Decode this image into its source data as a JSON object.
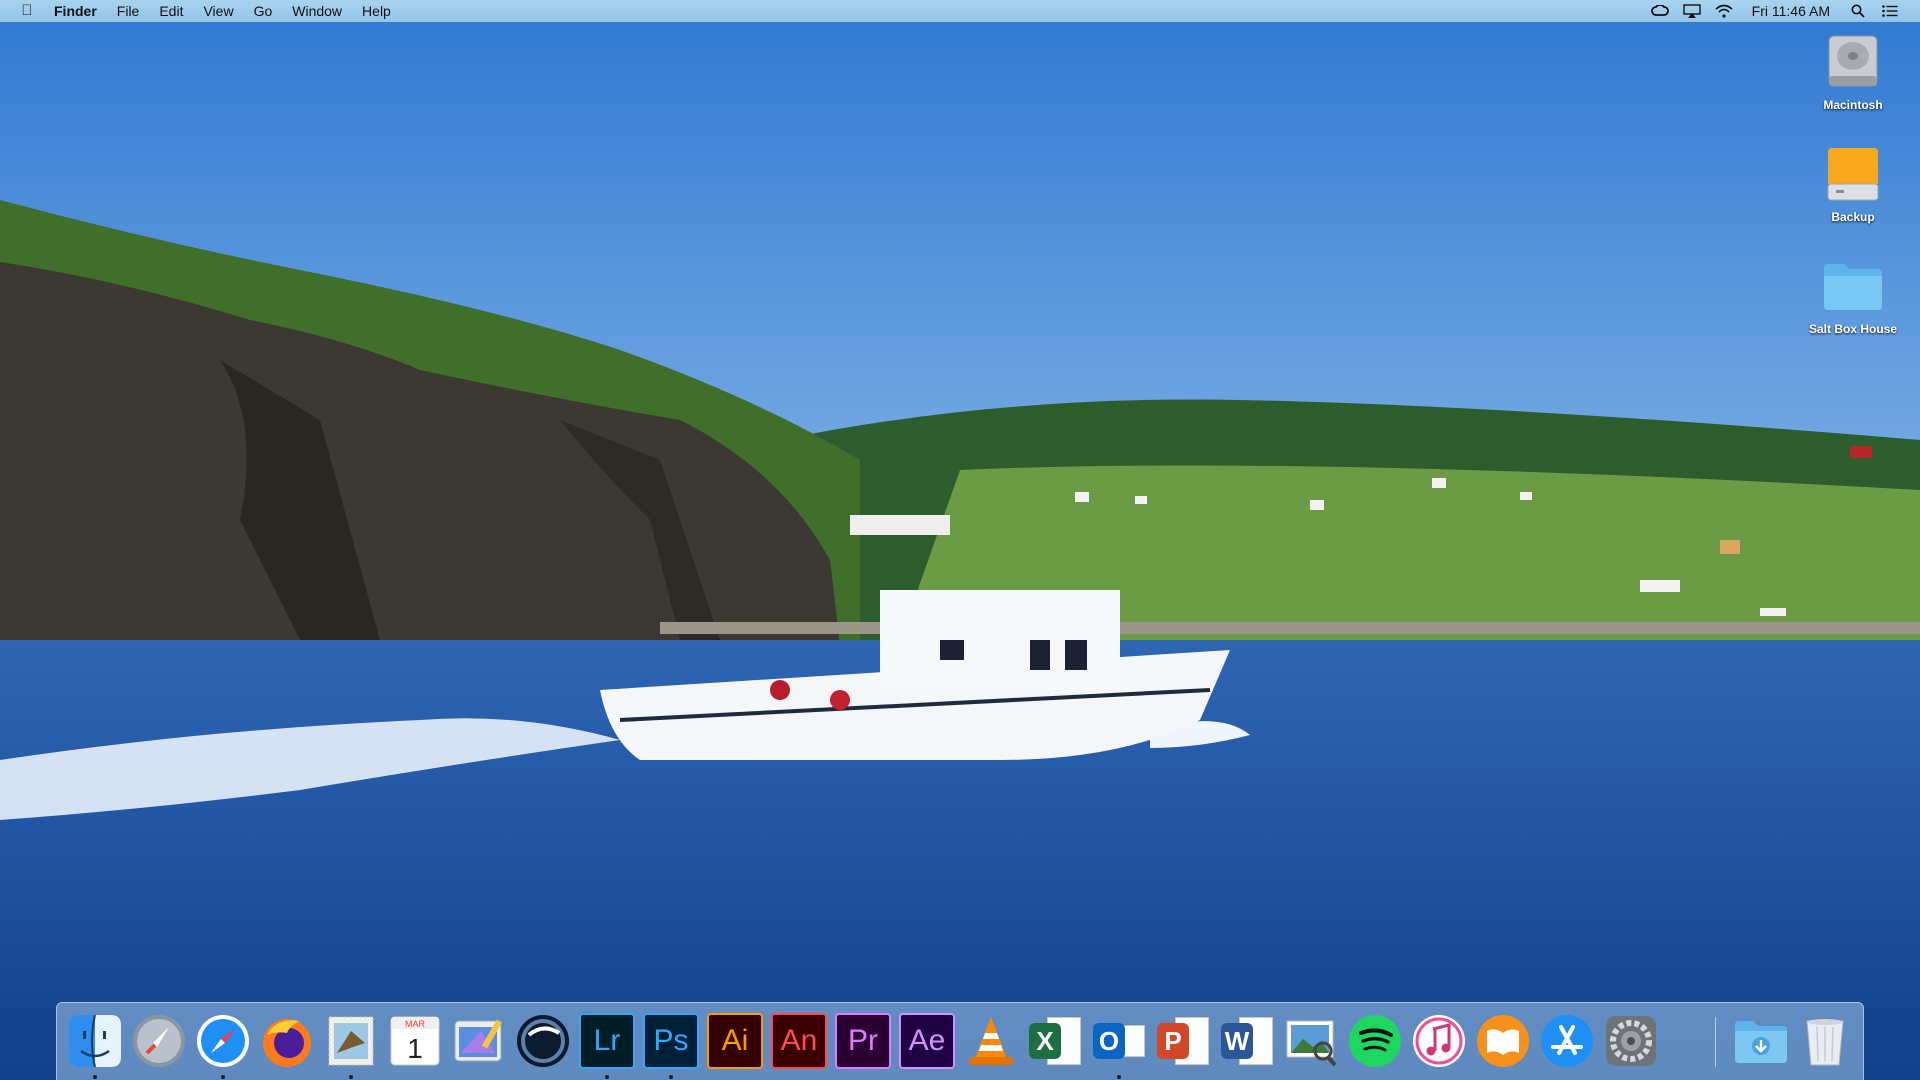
{
  "menubar": {
    "apple_icon": "apple-logo-icon",
    "app_name": "Finder",
    "menus": [
      "File",
      "Edit",
      "View",
      "Go",
      "Window",
      "Help"
    ],
    "status_icons": [
      "creative-cloud-icon",
      "airplay-icon",
      "wifi-icon"
    ],
    "clock": "Fri 11:46 AM",
    "right_icons": [
      "spotlight-search-icon",
      "notification-center-icon"
    ]
  },
  "desktop": {
    "icons": [
      {
        "name": "macintosh-drive",
        "label": "Macintosh",
        "icon": "internal-drive-icon"
      },
      {
        "name": "backup-drive",
        "label": "Backup",
        "icon": "external-drive-icon"
      },
      {
        "name": "salt-box-house-folder",
        "label": "Salt Box House",
        "icon": "folder-icon"
      }
    ]
  },
  "dock": {
    "apps": [
      {
        "name": "finder",
        "icon": "finder-icon",
        "running": true
      },
      {
        "name": "launchpad",
        "icon": "launchpad-rocket-icon",
        "running": false
      },
      {
        "name": "safari",
        "icon": "safari-compass-icon",
        "running": true
      },
      {
        "name": "firefox",
        "icon": "firefox-icon",
        "running": false
      },
      {
        "name": "mail",
        "icon": "mail-eagle-stamp-icon",
        "running": true
      },
      {
        "name": "calendar",
        "icon": "calendar-icon",
        "running": false,
        "month": "MAR",
        "day": "1"
      },
      {
        "name": "web-editor",
        "icon": "code-editor-icon",
        "running": false
      },
      {
        "name": "cinema-4d",
        "icon": "cinema4d-icon",
        "running": false
      },
      {
        "name": "lightroom",
        "icon": "lightroom-icon",
        "running": true,
        "text": "Lr",
        "bg": "#001d26",
        "fg": "#31a8ff"
      },
      {
        "name": "photoshop",
        "icon": "photoshop-icon",
        "running": true,
        "text": "Ps",
        "bg": "#001e36",
        "fg": "#31a8ff"
      },
      {
        "name": "illustrator",
        "icon": "illustrator-icon",
        "running": false,
        "text": "Ai",
        "bg": "#330000",
        "fg": "#ff9a00"
      },
      {
        "name": "animate",
        "icon": "animate-icon",
        "running": false,
        "text": "An",
        "bg": "#3a0000",
        "fg": "#ff4b4b"
      },
      {
        "name": "premiere-pro",
        "icon": "premiere-icon",
        "running": false,
        "text": "Pr",
        "bg": "#2a0033",
        "fg": "#e579ff"
      },
      {
        "name": "after-effects",
        "icon": "after-effects-icon",
        "running": false,
        "text": "Ae",
        "bg": "#1f0040",
        "fg": "#d291ff"
      },
      {
        "name": "vlc",
        "icon": "vlc-cone-icon",
        "running": false
      },
      {
        "name": "excel",
        "icon": "excel-icon",
        "running": false,
        "text": "X",
        "bg": "#1d6f42"
      },
      {
        "name": "outlook",
        "icon": "outlook-icon",
        "running": true,
        "text": "O",
        "bg": "#0a64c2"
      },
      {
        "name": "powerpoint",
        "icon": "powerpoint-icon",
        "running": false,
        "text": "P",
        "bg": "#d24726"
      },
      {
        "name": "word",
        "icon": "word-icon",
        "running": false,
        "text": "W",
        "bg": "#2b579a"
      },
      {
        "name": "preview",
        "icon": "preview-icon",
        "running": false
      },
      {
        "name": "spotify",
        "icon": "spotify-icon",
        "running": false
      },
      {
        "name": "itunes",
        "icon": "itunes-note-icon",
        "running": false
      },
      {
        "name": "ibooks",
        "icon": "ibooks-icon",
        "running": false
      },
      {
        "name": "app-store",
        "icon": "app-store-icon",
        "running": false
      },
      {
        "name": "system-preferences",
        "icon": "system-preferences-gear-icon",
        "running": false
      }
    ],
    "extras": [
      {
        "name": "downloads-stack",
        "icon": "downloads-folder-icon"
      },
      {
        "name": "trash",
        "icon": "trash-icon"
      }
    ]
  }
}
